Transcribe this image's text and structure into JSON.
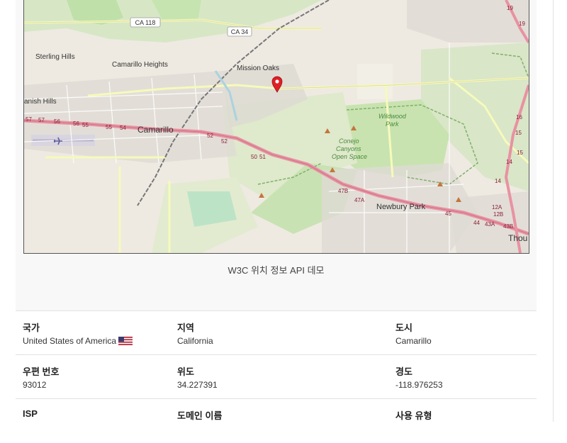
{
  "map": {
    "places": {
      "sterling_hills": "Sterling Hills",
      "camarillo_heights": "Camarillo Heights",
      "mission_oaks": "Mission Oaks",
      "spanish_hills": "anish Hills",
      "camarillo": "Camarillo",
      "wildwood_park": [
        "Wildwood",
        "Park"
      ],
      "conejo": [
        "Conejo",
        "Canyons",
        "Open Space"
      ],
      "newbury_park": "Newbury Park",
      "thousand_oaks": "Thou"
    },
    "shields": {
      "ca118": "CA 118",
      "ca34": "CA 34"
    },
    "exits": [
      "57",
      "57",
      "56",
      "56",
      "55",
      "55",
      "54",
      "52",
      "52",
      "50",
      "51",
      "47B",
      "47A",
      "45",
      "44",
      "43A",
      "43B",
      "12A",
      "12B",
      "14",
      "14",
      "15",
      "15",
      "16",
      "19",
      "19"
    ]
  },
  "caption": "W3C 위치 정보 API 데모",
  "table": {
    "rows": [
      [
        {
          "label": "국가",
          "value": "United States of America"
        },
        {
          "label": "지역",
          "value": "California"
        },
        {
          "label": "도시",
          "value": "Camarillo"
        }
      ],
      [
        {
          "label": "우편 번호",
          "value": "93012"
        },
        {
          "label": "위도",
          "value": "34.227391"
        },
        {
          "label": "경도",
          "value": "-118.976253"
        }
      ],
      [
        {
          "label": "ISP",
          "value": ""
        },
        {
          "label": "도메인 이름",
          "value": ""
        },
        {
          "label": "사용 유형",
          "value": ""
        }
      ]
    ]
  },
  "colors": {
    "motorway": "#e892a2",
    "primary": "#f6fabb",
    "park": "#c8e6b4",
    "marker": "#e01f25"
  },
  "icons": {
    "flag": "us-flag-icon",
    "marker": "location-pin-icon",
    "airport": "airplane-icon"
  }
}
